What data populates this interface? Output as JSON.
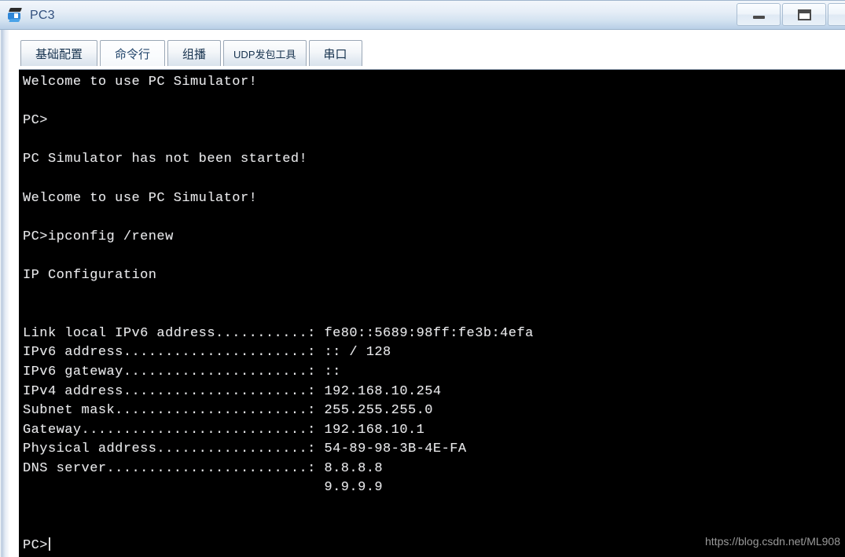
{
  "window": {
    "title": "PC3",
    "icon": "pc-simulator-icon",
    "controls": {
      "minimize_label": "–",
      "maximize_label": "❐"
    }
  },
  "tabs": [
    {
      "label": "基础配置",
      "selected": false,
      "small": false
    },
    {
      "label": "命令行",
      "selected": true,
      "small": false
    },
    {
      "label": "组播",
      "selected": false,
      "small": false
    },
    {
      "label": "UDP发包工具",
      "selected": false,
      "small": true
    },
    {
      "label": "串口",
      "selected": false,
      "small": false
    }
  ],
  "terminal": {
    "prompt": "PC>",
    "lines": [
      "Welcome to use PC Simulator!",
      "",
      "PC>",
      "",
      "PC Simulator has not been started!",
      "",
      "Welcome to use PC Simulator!",
      "",
      "PC>ipconfig /renew",
      "",
      "IP Configuration",
      "",
      "",
      "Link local IPv6 address...........: fe80::5689:98ff:fe3b:4efa",
      "IPv6 address......................: :: / 128",
      "IPv6 gateway......................: ::",
      "IPv4 address......................: 192.168.10.254",
      "Subnet mask.......................: 255.255.255.0",
      "Gateway...........................: 192.168.10.1",
      "Physical address..................: 54-89-98-3B-4E-FA",
      "DNS server........................: 8.8.8.8",
      "                                    9.9.9.9",
      "",
      ""
    ],
    "command_entered": "ipconfig /renew",
    "ip_configuration": {
      "heading": "IP Configuration",
      "fields": [
        {
          "label": "Link local IPv6 address",
          "value": "fe80::5689:98ff:fe3b:4efa"
        },
        {
          "label": "IPv6 address",
          "value": ":: / 128"
        },
        {
          "label": "IPv6 gateway",
          "value": "::"
        },
        {
          "label": "IPv4 address",
          "value": "192.168.10.254"
        },
        {
          "label": "Subnet mask",
          "value": "255.255.255.0"
        },
        {
          "label": "Gateway",
          "value": "192.168.10.1"
        },
        {
          "label": "Physical address",
          "value": "54-89-98-3B-4E-FA"
        },
        {
          "label": "DNS server",
          "value": "8.8.8.8"
        },
        {
          "label": "",
          "value": "9.9.9.9"
        }
      ]
    },
    "messages": [
      "Welcome to use PC Simulator!",
      "PC Simulator has not been started!"
    ],
    "colors": {
      "background": "#000000",
      "text": "#e9e9ea"
    }
  },
  "watermark": {
    "text": "https://blog.csdn.net/ML908"
  }
}
